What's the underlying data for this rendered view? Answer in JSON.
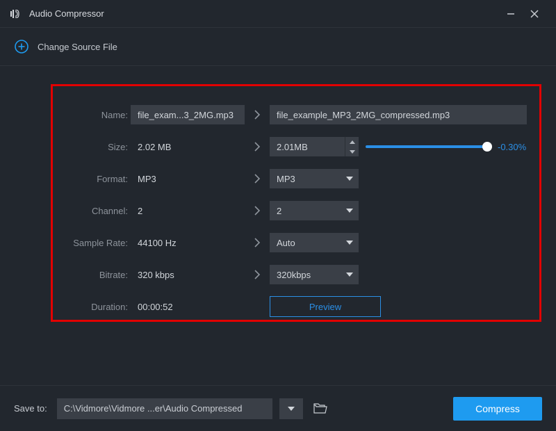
{
  "app": {
    "title": "Audio Compressor"
  },
  "source": {
    "change_label": "Change Source File"
  },
  "fields": {
    "name": {
      "label": "Name:",
      "src": "file_exam...3_2MG.mp3",
      "dst": "file_example_MP3_2MG_compressed.mp3"
    },
    "size": {
      "label": "Size:",
      "src": "2.02 MB",
      "dst": "2.01MB",
      "pct": "-0.30%"
    },
    "format": {
      "label": "Format:",
      "src": "MP3",
      "dst": "MP3"
    },
    "channel": {
      "label": "Channel:",
      "src": "2",
      "dst": "2"
    },
    "sample_rate": {
      "label": "Sample Rate:",
      "src": "44100 Hz",
      "dst": "Auto"
    },
    "bitrate": {
      "label": "Bitrate:",
      "src": "320 kbps",
      "dst": "320kbps"
    },
    "duration": {
      "label": "Duration:",
      "src": "00:00:52"
    }
  },
  "buttons": {
    "preview": "Preview",
    "compress": "Compress"
  },
  "footer": {
    "save_to_label": "Save to:",
    "path": "C:\\Vidmore\\Vidmore ...er\\Audio Compressed"
  }
}
